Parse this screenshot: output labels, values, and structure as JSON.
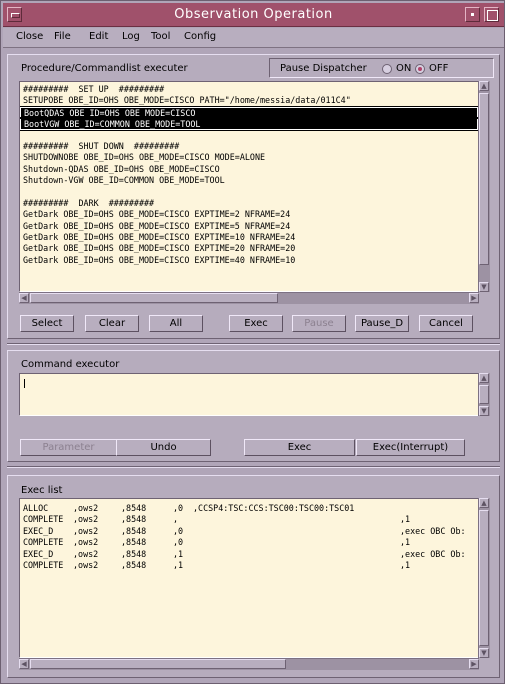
{
  "window": {
    "title": "Observation Operation"
  },
  "menu": [
    "Close",
    "File",
    "Edit",
    "Log",
    "Tool",
    "Config"
  ],
  "procedure": {
    "label": "Procedure/Commandlist executer",
    "pause_dispatcher": {
      "label": "Pause Dispatcher",
      "on_label": "ON",
      "off_label": "OFF",
      "selected": "OFF"
    },
    "lines": [
      "#########  SET UP  #########",
      "SETUPOBE OBE_ID=OHS OBE_MODE=CISCO PATH=\"/home/messia/data/011C4\"",
      "BootQDAS OBE_ID=OHS OBE_MODE=CISCO",
      "BootVGW OBE_ID=COMMON OBE_MODE=TOOL",
      "",
      "#########  SHUT DOWN  #########",
      "SHUTDOWNOBE OBE_ID=OHS OBE_MODE=CISCO MODE=ALONE",
      "Shutdown-QDAS OBE_ID=OHS OBE_MODE=CISCO",
      "Shutdown-VGW OBE_ID=COMMON OBE_MODE=TOOL",
      "",
      "#########  DARK  #########",
      "GetDark OBE_ID=OHS OBE_MODE=CISCO EXPTIME=2 NFRAME=24",
      "GetDark OBE_ID=OHS OBE_MODE=CISCO EXPTIME=5 NFRAME=24",
      "GetDark OBE_ID=OHS OBE_MODE=CISCO EXPTIME=10 NFRAME=24",
      "GetDark OBE_ID=OHS OBE_MODE=CISCO EXPTIME=20 NFRAME=20",
      "GetDark OBE_ID=OHS OBE_MODE=CISCO EXPTIME=40 NFRAME=10"
    ],
    "selected_lines": [
      2,
      3
    ],
    "buttons": {
      "select": "Select",
      "clear": "Clear",
      "all": "All",
      "exec": "Exec",
      "pause": "Pause",
      "pause_d": "Pause_D",
      "cancel": "Cancel"
    }
  },
  "command": {
    "label": "Command executor",
    "value": "",
    "buttons": {
      "parameter": "Parameter",
      "undo": "Undo",
      "exec": "Exec",
      "exec_interrupt": "Exec(Interrupt)"
    }
  },
  "exec_list": {
    "label": "Exec list",
    "rows": [
      {
        "status": "ALLOC",
        "host": ",ows2",
        "id": ",8548",
        "code": ",0",
        "detail": ",CCSP4:TSC:CCS:TSC00:TSC00:TSC01",
        "note": ""
      },
      {
        "status": "COMPLETE",
        "host": ",ows2",
        "id": ",8548",
        "code": ",",
        "detail": "",
        "note": ",1"
      },
      {
        "status": "EXEC_D",
        "host": ",ows2",
        "id": ",8548",
        "code": ",0",
        "detail": "",
        "note": ",exec OBC Ob:"
      },
      {
        "status": "COMPLETE",
        "host": ",ows2",
        "id": ",8548",
        "code": ",0",
        "detail": "",
        "note": ",1"
      },
      {
        "status": "EXEC_D",
        "host": ",ows2",
        "id": ",8548",
        "code": ",1",
        "detail": "",
        "note": ",exec OBC Ob:"
      },
      {
        "status": "COMPLETE",
        "host": ",ows2",
        "id": ",8548",
        "code": ",1",
        "detail": "",
        "note": ",1"
      }
    ]
  },
  "colors": {
    "titlebar": "#a0516b",
    "window_bg": "#b0a5b8",
    "text_area": "#fdf5dc",
    "radio_selected": "#b0436a"
  }
}
